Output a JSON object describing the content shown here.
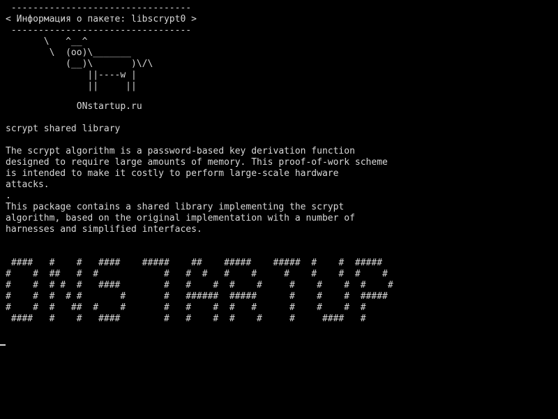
{
  "cowsay": {
    "lines": [
      " ---------------------------------",
      "< Информация о пакете: libscrypt0 >",
      " ---------------------------------",
      "       \\   ^__^",
      "        \\  (oo)\\_______",
      "           (__)\\       )\\/\\",
      "               ||----w |",
      "               ||     ||"
    ]
  },
  "site": {
    "label": "             ONstartup.ru"
  },
  "package": {
    "summary": "scrypt shared library",
    "description_lines": [
      "The scrypt algorithm is a password-based key derivation function",
      "designed to require large amounts of memory. This proof-of-work scheme",
      "is intended to make it costly to perform large-scale hardware",
      "attacks.",
      ".",
      "This package contains a shared library implementing the scrypt",
      "algorithm, based on the original implementation with a number of",
      "harnesses and simplified interfaces."
    ]
  },
  "banner": {
    "lines": [
      " ####   #    #   ####    #####    ##    #####    #####  #    #  #####",
      "#    #  ##   #  #            #   #  #   #    #     #    #    #  #    #",
      "#    #  # #  #   ####        #   #    #  #    #     #    #    #  #    #",
      "#    #  #  # #       #       #   ######  #####      #    #    #  #####",
      "#    #  #   ##  #    #       #   #    #  #   #      #    #    #  #",
      " ####   #    #   ####        #   #    #  #    #     #     ####   #"
    ]
  }
}
